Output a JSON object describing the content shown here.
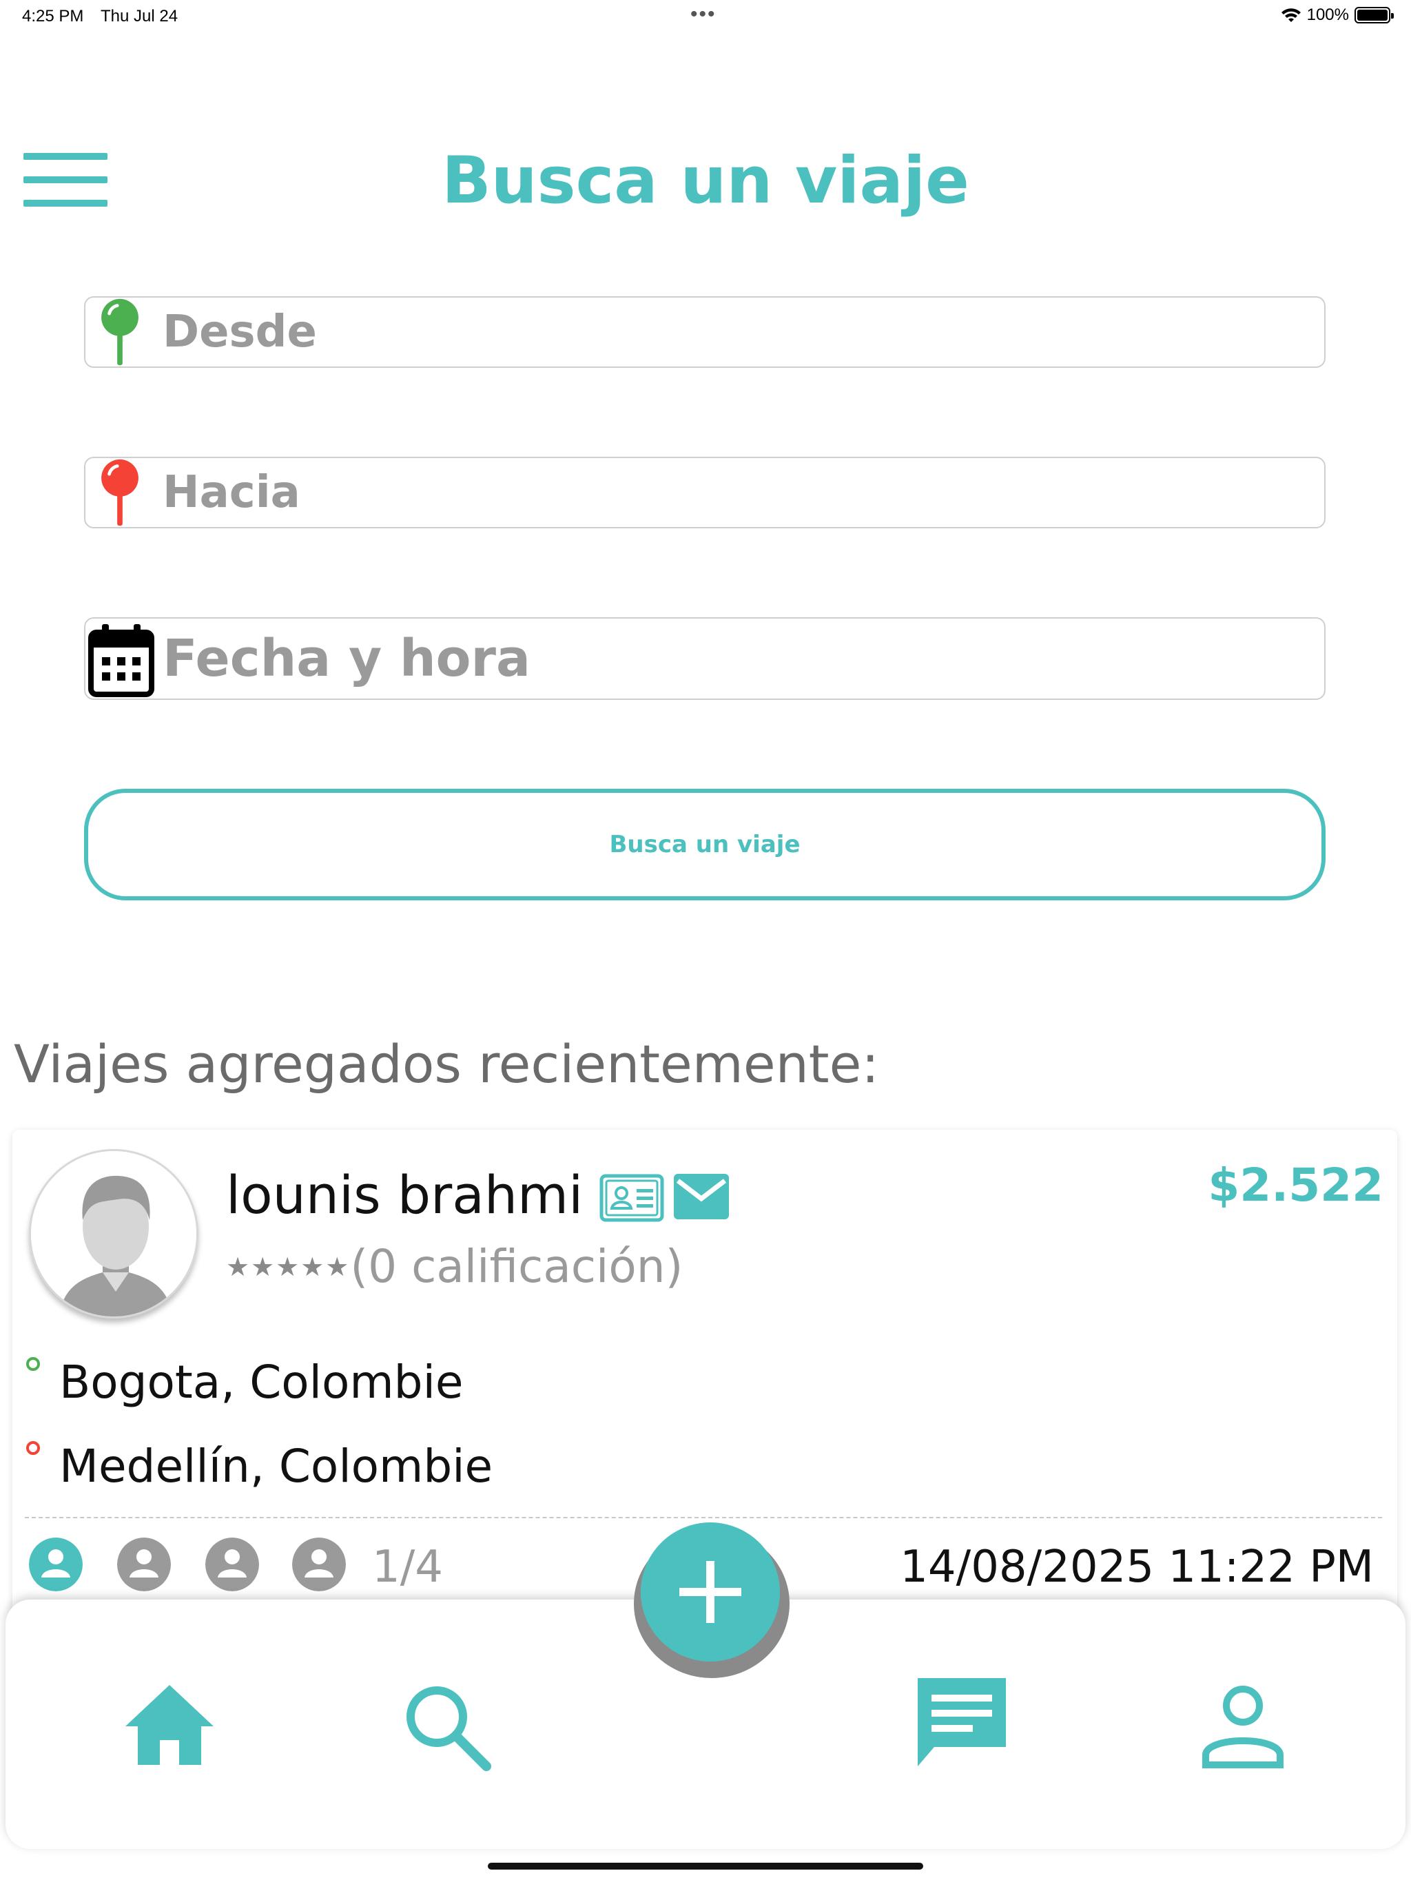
{
  "status_bar": {
    "time": "4:25 PM",
    "date": "Thu Jul 24",
    "battery": "100%"
  },
  "header": {
    "title": "Busca un viaje",
    "menu_icon": "hamburger-menu-icon"
  },
  "search_form": {
    "from_placeholder": "Desde",
    "to_placeholder": "Hacia",
    "date_placeholder": "Fecha y hora",
    "button_label": "Busca un viaje"
  },
  "recent": {
    "title": "Viajes agregados recientemente:",
    "trips": [
      {
        "driver_name": "lounis brahmi",
        "stars": "★★★★★",
        "rating_text": "(0 calificación)",
        "price": "$2.522",
        "from": "Bogota, Colombie",
        "to": "Medellín, Colombie",
        "seats_taken": 1,
        "seats_total": 4,
        "seats_text": "1/4",
        "datetime": "14/08/2025 11:22 PM"
      }
    ]
  },
  "colors": {
    "accent": "#4bc0be",
    "from_pin": "#4caf50",
    "to_pin": "#f44336",
    "seat_inactive": "#9a9a9a"
  },
  "bottom_nav": {
    "items": [
      "home-icon",
      "search-icon",
      "add-icon",
      "chat-icon",
      "profile-icon"
    ]
  }
}
